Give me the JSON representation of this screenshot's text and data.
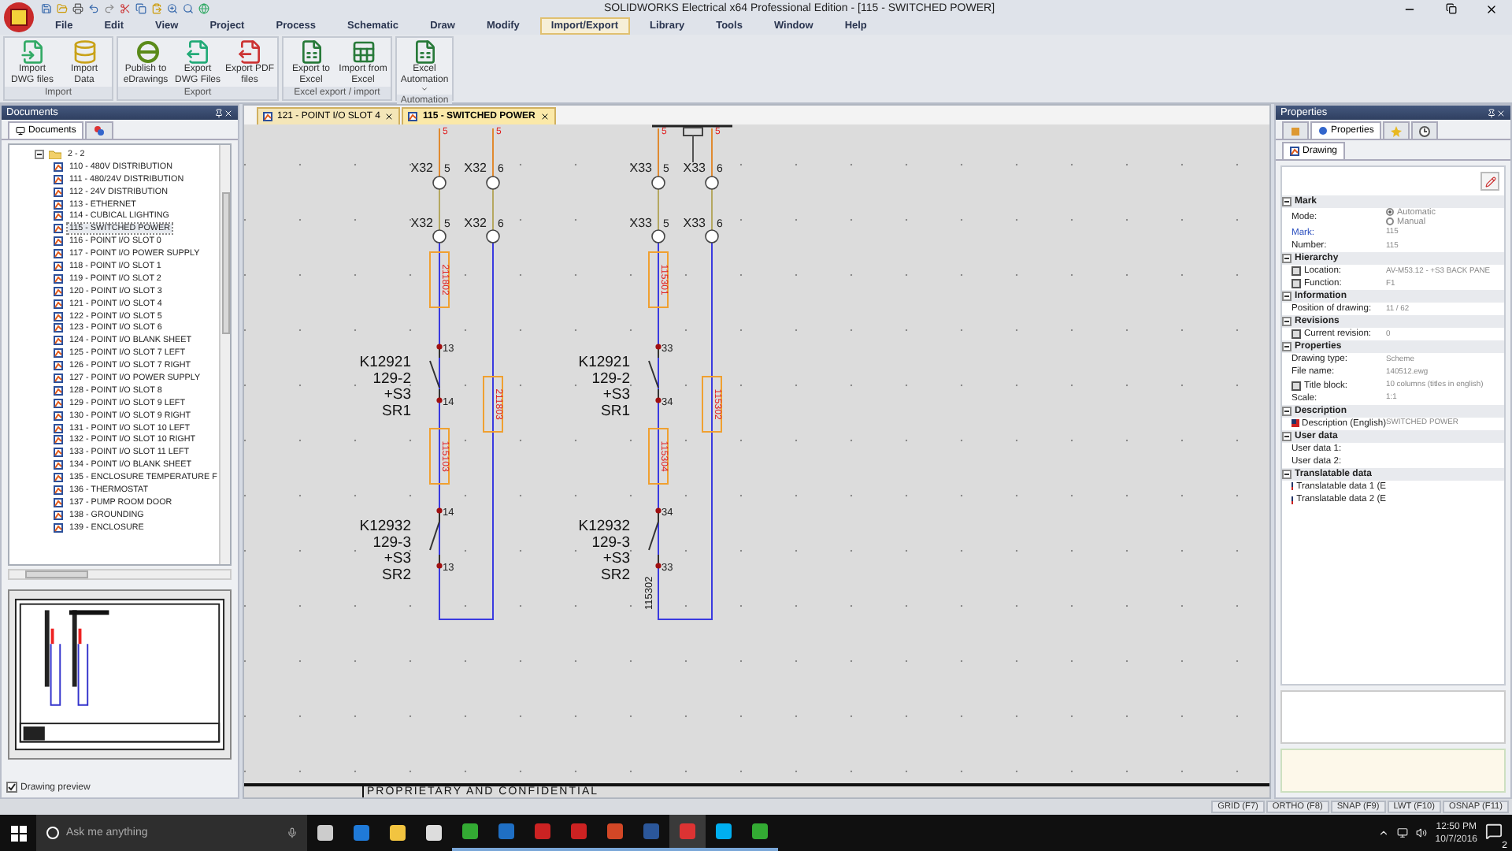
{
  "app": {
    "title": "SOLIDWORKS Electrical x64 Professional Edition - [115 - SWITCHED POWER]"
  },
  "menu": [
    {
      "label": "File",
      "selected": false
    },
    {
      "label": "Edit",
      "selected": false
    },
    {
      "label": "View",
      "selected": false
    },
    {
      "label": "Project",
      "selected": false
    },
    {
      "label": "Process",
      "selected": false
    },
    {
      "label": "Schematic",
      "selected": false
    },
    {
      "label": "Draw",
      "selected": false
    },
    {
      "label": "Modify",
      "selected": false
    },
    {
      "label": "Import/Export",
      "selected": true
    },
    {
      "label": "Library",
      "selected": false
    },
    {
      "label": "Tools",
      "selected": false
    },
    {
      "label": "Window",
      "selected": false
    },
    {
      "label": "Help",
      "selected": false
    }
  ],
  "ribbon_groups": [
    {
      "title": "Import",
      "buttons": [
        {
          "label": "Import DWG files",
          "kind": "dwg_in"
        },
        {
          "label": "Import Data",
          "kind": "database"
        }
      ]
    },
    {
      "title": "Export",
      "buttons": [
        {
          "label": "Publish to eDrawings",
          "kind": "edrawings"
        },
        {
          "label": "Export DWG Files",
          "kind": "dwg_out"
        },
        {
          "label": "Export PDF files",
          "kind": "pdf"
        }
      ]
    },
    {
      "title": "Excel export / import",
      "buttons": [
        {
          "label": "Export to Excel",
          "kind": "xls_out"
        },
        {
          "label": "Import from Excel",
          "kind": "xls_in"
        }
      ]
    },
    {
      "title": "Automation",
      "buttons": [
        {
          "label": "Excel Automation",
          "kind": "automation",
          "has_menu": true
        }
      ]
    }
  ],
  "documents_panel": {
    "title": "Documents",
    "tabs": [
      {
        "label": "Documents",
        "selected": true
      },
      {
        "selected": false
      }
    ],
    "folder": "2 - 2",
    "items": [
      {
        "label": "110 - 480V DISTRIBUTION",
        "selected": false
      },
      {
        "label": "111 - 480/24V DISTRIBUTION",
        "selected": false
      },
      {
        "label": "112 - 24V DISTRIBUTION",
        "selected": false
      },
      {
        "label": "113 - ETHERNET",
        "selected": false
      },
      {
        "label": "114 - CUBICAL LIGHTING",
        "selected": false
      },
      {
        "label": "115 - SWITCHED POWER",
        "selected": true
      },
      {
        "label": "116 - POINT I/O SLOT 0",
        "selected": false
      },
      {
        "label": "117 - POINT I/O POWER SUPPLY",
        "selected": false
      },
      {
        "label": "118 - POINT I/O SLOT 1",
        "selected": false
      },
      {
        "label": "119 - POINT I/O SLOT 2",
        "selected": false
      },
      {
        "label": "120 - POINT I/O SLOT 3",
        "selected": false
      },
      {
        "label": "121 - POINT I/O SLOT 4",
        "selected": false
      },
      {
        "label": "122 - POINT I/O SLOT 5",
        "selected": false
      },
      {
        "label": "123 - POINT I/O SLOT 6",
        "selected": false
      },
      {
        "label": "124 - POINT I/O BLANK SHEET",
        "selected": false
      },
      {
        "label": "125 - POINT I/O SLOT 7 LEFT",
        "selected": false
      },
      {
        "label": "126 - POINT I/O SLOT 7 RIGHT",
        "selected": false
      },
      {
        "label": "127 - POINT I/O POWER SUPPLY",
        "selected": false
      },
      {
        "label": "128 - POINT I/O SLOT 8",
        "selected": false
      },
      {
        "label": "129 - POINT I/O SLOT 9 LEFT",
        "selected": false
      },
      {
        "label": "130 - POINT I/O SLOT 9 RIGHT",
        "selected": false
      },
      {
        "label": "131 - POINT I/O SLOT 10 LEFT",
        "selected": false
      },
      {
        "label": "132 - POINT I/O SLOT 10 RIGHT",
        "selected": false
      },
      {
        "label": "133 - POINT I/O SLOT 11 LEFT",
        "selected": false
      },
      {
        "label": "134 - POINT I/O BLANK SHEET",
        "selected": false
      },
      {
        "label": "135 - ENCLOSURE TEMPERATURE F",
        "selected": false
      },
      {
        "label": "136 - THERMOSTAT",
        "selected": false
      },
      {
        "label": "137 - PUMP ROOM DOOR",
        "selected": false
      },
      {
        "label": "138 - GROUNDING",
        "selected": false
      },
      {
        "label": "139 - ENCLOSURE",
        "selected": false
      }
    ],
    "preview_checkbox": {
      "label": "Drawing preview",
      "checked": true
    }
  },
  "document_tabs": [
    {
      "label": "121 - POINT I/O SLOT 4",
      "selected": false
    },
    {
      "label": "115 - SWITCHED POWER",
      "selected": true
    }
  ],
  "schematic": {
    "circuits": [
      {
        "top_marks": [
          "5",
          "5"
        ],
        "terminals": [
          {
            "mark": "X32",
            "pin": "5"
          },
          {
            "mark": "X32",
            "pin": "6"
          },
          {
            "mark": "X32",
            "pin": "5"
          },
          {
            "mark": "X32",
            "pin": "6"
          }
        ],
        "wire_numbers": [
          "211802",
          "211803",
          "115103"
        ],
        "contacts": [
          {
            "ref": [
              "K12921",
              "129-2",
              "+S3",
              "SR1"
            ],
            "pins": [
              "13",
              "14"
            ]
          },
          {
            "ref": [
              "K12932",
              "129-3",
              "+S3",
              "SR2"
            ],
            "pins": [
              "14",
              "13"
            ]
          }
        ]
      },
      {
        "top_marks": [
          "5",
          "5"
        ],
        "terminals": [
          {
            "mark": "X33",
            "pin": "5"
          },
          {
            "mark": "X33",
            "pin": "6"
          },
          {
            "mark": "X33",
            "pin": "5"
          },
          {
            "mark": "X33",
            "pin": "6"
          }
        ],
        "wire_numbers": [
          "115301",
          "115302",
          "115304"
        ],
        "contacts": [
          {
            "ref": [
              "K12921",
              "129-2",
              "+S3",
              "SR1"
            ],
            "pins": [
              "33",
              "34"
            ]
          },
          {
            "ref": [
              "K12932",
              "129-3",
              "+S3",
              "SR2"
            ],
            "pins": [
              "34",
              "33"
            ]
          }
        ],
        "side_label": "115302",
        "bus_connector": true
      }
    ],
    "title_block": "PROPRIETARY AND CONFIDENTIAL"
  },
  "properties_panel": {
    "title": "Properties",
    "tabs": [
      {
        "selected": false
      },
      {
        "label": "Properties",
        "selected": true
      },
      {
        "selected": false
      },
      {
        "selected": false
      }
    ],
    "sub_tabs": [
      {
        "label": "Drawing",
        "selected": true
      }
    ],
    "sections": [
      {
        "title": "Mark",
        "rows": [
          {
            "kind": "radio",
            "label": "Mode:",
            "options": [
              {
                "label": "Automatic",
                "selected": true
              },
              {
                "label": "Manual",
                "selected": false
              }
            ]
          },
          {
            "kind": "link_field",
            "label": "Mark:",
            "value": "115"
          },
          {
            "kind": "field",
            "label": "Number:",
            "value": "115"
          }
        ]
      },
      {
        "title": "Hierarchy",
        "rows": [
          {
            "kind": "icon_field",
            "label": "Location:",
            "value": "AV-M53.12 - +S3 BACK PANE"
          },
          {
            "kind": "icon_field",
            "label": "Function:",
            "value": "F1"
          }
        ]
      },
      {
        "title": "Information",
        "rows": [
          {
            "kind": "field",
            "label": "Position of drawing:",
            "value": "11 / 62"
          }
        ]
      },
      {
        "title": "Revisions",
        "rows": [
          {
            "kind": "icon_field",
            "label": "Current revision:",
            "value": "0"
          }
        ]
      },
      {
        "title": "Properties",
        "rows": [
          {
            "kind": "field",
            "label": "Drawing type:",
            "value": "Scheme"
          },
          {
            "kind": "field",
            "label": "File name:",
            "value": "140512.ewg"
          },
          {
            "kind": "icon_field",
            "label": "Title block:",
            "value": "10 columns (titles in english)"
          },
          {
            "kind": "field",
            "label": "Scale:",
            "value": "1:1"
          }
        ]
      },
      {
        "title": "Description",
        "rows": [
          {
            "kind": "flag_field",
            "label": "Description (English)",
            "value": "SWITCHED POWER"
          }
        ]
      },
      {
        "title": "User data",
        "rows": [
          {
            "kind": "field",
            "label": "User data 1:"
          },
          {
            "kind": "field",
            "label": "User data 2:"
          }
        ]
      },
      {
        "title": "Translatable data",
        "rows": [
          {
            "kind": "flag_field",
            "label": "Translatable data 1 (E"
          },
          {
            "kind": "flag_field",
            "label": "Translatable data 2 (E"
          }
        ]
      }
    ]
  },
  "status_toggles": [
    "GRID (F7)",
    "ORTHO (F8)",
    "SNAP (F9)",
    "LWT (F10)",
    "OSNAP (F11)"
  ],
  "taskbar": {
    "search_placeholder": "Ask me anything",
    "time": "12:50 PM",
    "date": "10/7/2016",
    "notifications": "2"
  }
}
